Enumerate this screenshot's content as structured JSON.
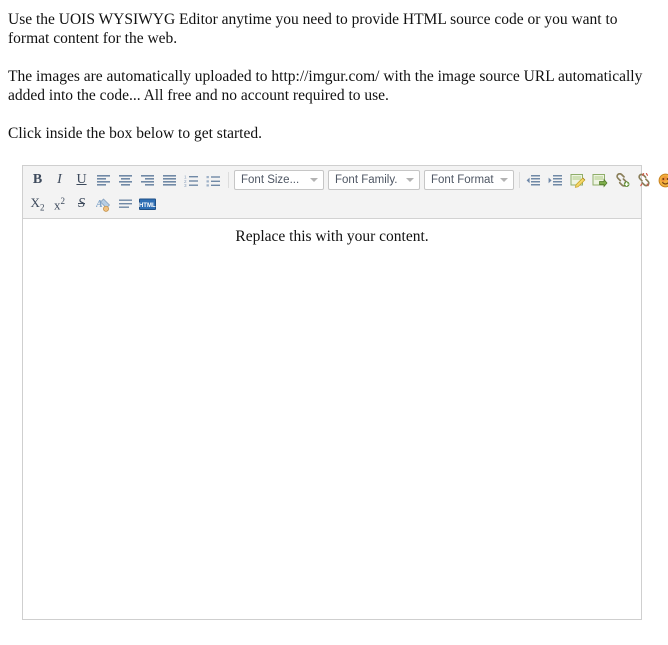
{
  "intro": {
    "paragraph_1": "Use the UOIS WYSIWYG Editor anytime you need to provide HTML source code or you want to format content for the web.",
    "paragraph_2": "The images are automatically uploaded to http://imgur.com/ with the image source URL automatically added into the code... All free and no account required to use.",
    "paragraph_3": "Click inside the box below to get started."
  },
  "editor": {
    "toolbar": {
      "row_1": [
        {
          "name": "bold-icon",
          "label": "B",
          "type": "glyph"
        },
        {
          "name": "italic-icon",
          "label": "I",
          "type": "glyph"
        },
        {
          "name": "underline-icon",
          "label": "U",
          "type": "glyph"
        },
        {
          "name": "align-left-icon",
          "label": "",
          "type": "icon"
        },
        {
          "name": "align-center-icon",
          "label": "",
          "type": "icon"
        },
        {
          "name": "align-right-icon",
          "label": "",
          "type": "icon"
        },
        {
          "name": "align-justify-icon",
          "label": "",
          "type": "icon"
        },
        {
          "name": "numbered-list-icon",
          "label": "",
          "type": "icon"
        },
        {
          "name": "bullet-list-icon",
          "label": "",
          "type": "icon"
        }
      ],
      "selects": [
        {
          "name": "font-size-select",
          "value": "Font Size..."
        },
        {
          "name": "font-family-select",
          "value": "Font Family."
        },
        {
          "name": "font-format-select",
          "value": "Font Format"
        }
      ],
      "row_1_tail": [
        {
          "name": "outdent-icon",
          "label": "",
          "type": "icon"
        },
        {
          "name": "indent-icon",
          "label": "",
          "type": "icon"
        },
        {
          "name": "insert-image-icon",
          "label": "",
          "type": "icon"
        },
        {
          "name": "insert-media-icon",
          "label": "",
          "type": "icon"
        },
        {
          "name": "insert-link-icon",
          "label": "",
          "type": "icon"
        },
        {
          "name": "unlink-icon",
          "label": "",
          "type": "icon"
        },
        {
          "name": "insert-emoticon-icon",
          "label": "",
          "type": "icon"
        },
        {
          "name": "edit-source-icon",
          "label": "",
          "type": "icon"
        }
      ],
      "row_2": [
        {
          "name": "subscript-icon",
          "label": "X2",
          "type": "glyph"
        },
        {
          "name": "superscript-icon",
          "label": "X2",
          "type": "glyph"
        },
        {
          "name": "strikethrough-icon",
          "label": "S",
          "type": "glyph"
        },
        {
          "name": "text-color-icon",
          "label": "A",
          "type": "icon"
        },
        {
          "name": "horizontal-rule-icon",
          "label": "",
          "type": "icon"
        },
        {
          "name": "html-source-icon",
          "label": "HTML",
          "type": "icon"
        }
      ]
    },
    "content": {
      "placeholder_text": "Replace this with your content."
    }
  },
  "colors": {
    "toolbar_background": "#f3f3f3",
    "toolbar_border": "#d2d2d2",
    "editor_border": "#cfcfcf",
    "icon_blue_gray": "#6d87a8",
    "icon_green": "#7aa84f",
    "icon_yellow": "#e8c24a",
    "html_button_blue": "#2f6fb5",
    "text": "#111111"
  }
}
